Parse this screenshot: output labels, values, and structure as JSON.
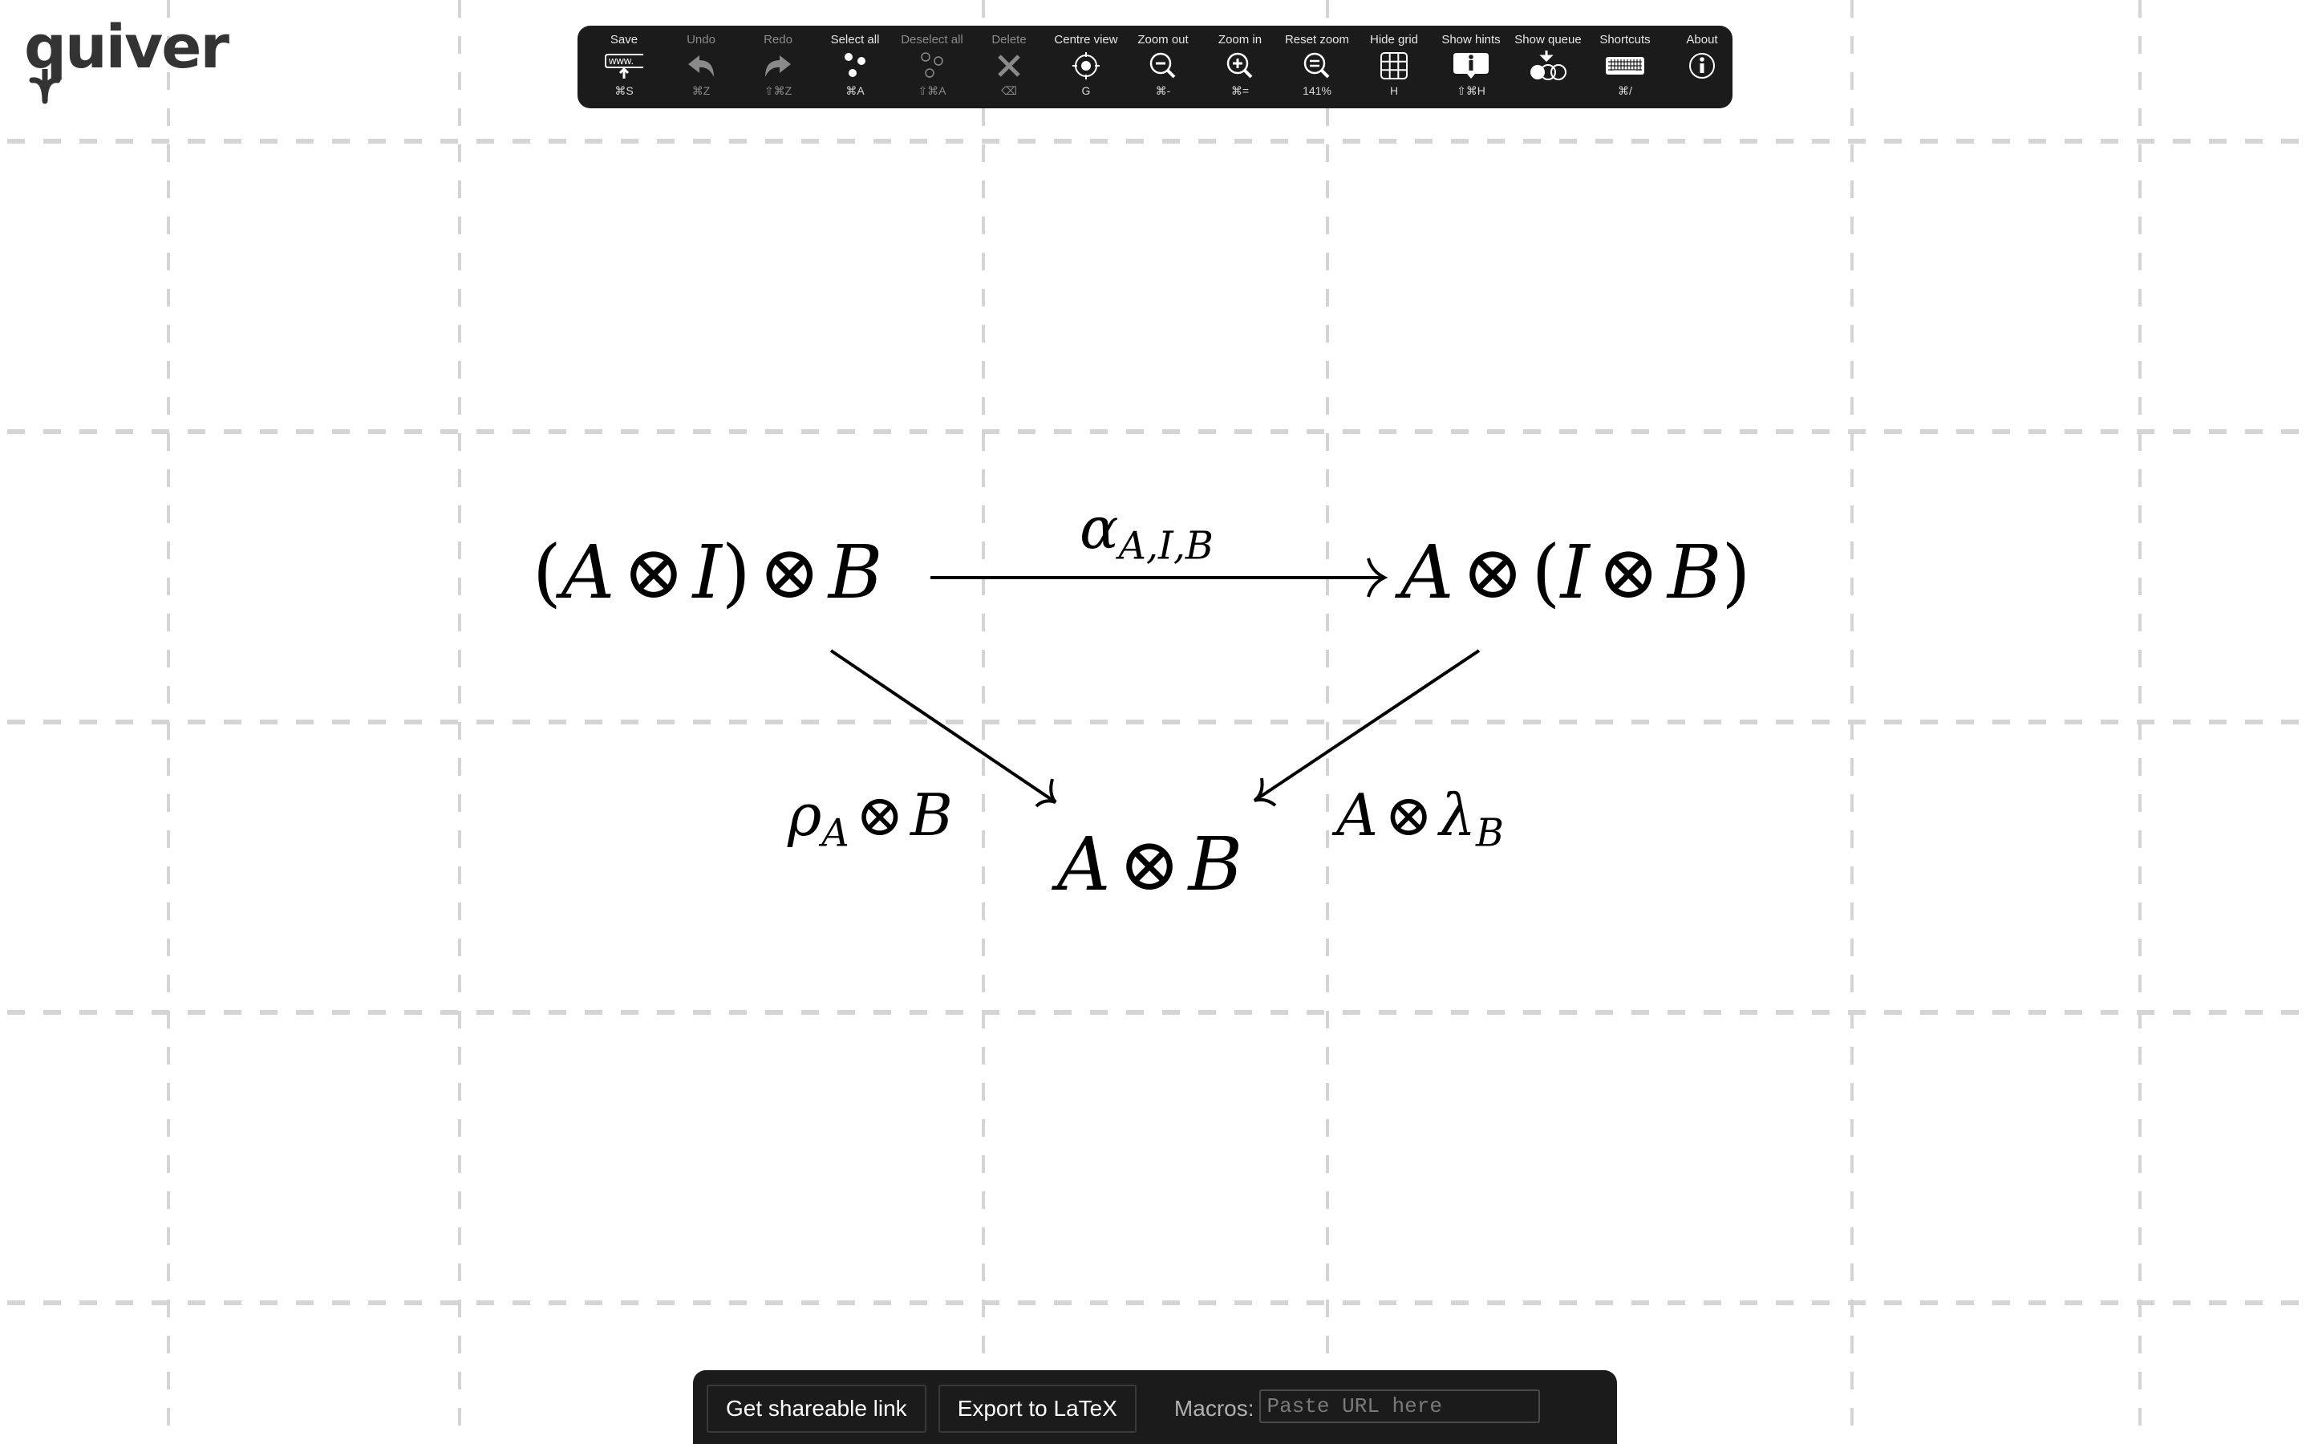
{
  "app": {
    "logo_text": "quiver"
  },
  "toolbar": {
    "items": [
      {
        "id": "save",
        "label": "Save",
        "icon": "save-url-icon",
        "shortcut": "⌘S",
        "enabled": true
      },
      {
        "id": "undo",
        "label": "Undo",
        "icon": "undo-icon",
        "shortcut": "⌘Z",
        "enabled": false
      },
      {
        "id": "redo",
        "label": "Redo",
        "icon": "redo-icon",
        "shortcut": "⇧⌘Z",
        "enabled": false
      },
      {
        "id": "select-all",
        "label": "Select all",
        "icon": "select-all-icon",
        "shortcut": "⌘A",
        "enabled": true
      },
      {
        "id": "deselect-all",
        "label": "Deselect all",
        "icon": "deselect-all-icon",
        "shortcut": "⇧⌘A",
        "enabled": false
      },
      {
        "id": "delete",
        "label": "Delete",
        "icon": "delete-icon",
        "shortcut": "⌫",
        "enabled": false
      },
      {
        "id": "centre-view",
        "label": "Centre view",
        "icon": "centre-view-icon",
        "shortcut": "G",
        "enabled": true
      },
      {
        "id": "zoom-out",
        "label": "Zoom out",
        "icon": "zoom-out-icon",
        "shortcut": "⌘-",
        "enabled": true
      },
      {
        "id": "zoom-in",
        "label": "Zoom in",
        "icon": "zoom-in-icon",
        "shortcut": "⌘=",
        "enabled": true
      },
      {
        "id": "reset-zoom",
        "label": "Reset zoom",
        "icon": "reset-zoom-icon",
        "shortcut": "141%",
        "enabled": true
      },
      {
        "id": "hide-grid",
        "label": "Hide grid",
        "icon": "grid-icon",
        "shortcut": "H",
        "enabled": true
      },
      {
        "id": "show-hints",
        "label": "Show hints",
        "icon": "hints-icon",
        "shortcut": "⇧⌘H",
        "enabled": true
      },
      {
        "id": "show-queue",
        "label": "Show queue",
        "icon": "queue-icon",
        "shortcut": "",
        "enabled": true
      },
      {
        "id": "shortcuts",
        "label": "Shortcuts",
        "icon": "keyboard-icon",
        "shortcut": "⌘/",
        "enabled": true
      },
      {
        "id": "about",
        "label": "About",
        "icon": "info-icon",
        "shortcut": "",
        "enabled": true
      }
    ]
  },
  "diagram": {
    "nodes": [
      {
        "id": "source",
        "tex": "(A \\otimes I) \\otimes B",
        "parts": {
          "open1": "(",
          "a": "A",
          "ot1": "⊗",
          "i": "I",
          "close1": ")",
          "ot2": "⊗",
          "b": "B"
        }
      },
      {
        "id": "target",
        "tex": "A \\otimes (I \\otimes B)",
        "parts": {
          "a": "A",
          "ot1": "⊗",
          "open1": "(",
          "i": "I",
          "ot2": "⊗",
          "b": "B",
          "close1": ")"
        }
      },
      {
        "id": "bottom",
        "tex": "A \\otimes B",
        "parts": {
          "a": "A",
          "ot1": "⊗",
          "b": "B"
        }
      }
    ],
    "edges": [
      {
        "id": "alpha",
        "from": "source",
        "to": "target",
        "tex": "\\alpha_{A,I,B}",
        "parts": {
          "sym": "α",
          "sub": "A,I,B"
        }
      },
      {
        "id": "rho",
        "from": "source",
        "to": "bottom",
        "tex": "\\rho_A \\otimes B",
        "parts": {
          "sym": "ρ",
          "sub": "A",
          "ot": "⊗",
          "rest": "B"
        }
      },
      {
        "id": "lambda",
        "from": "target",
        "to": "bottom",
        "tex": "A \\otimes \\lambda_B",
        "parts": {
          "pre": "A",
          "ot": "⊗",
          "sym": "λ",
          "sub": "B"
        }
      }
    ]
  },
  "bottom_panel": {
    "share_button": "Get shareable link",
    "export_button": "Export to LaTeX",
    "macros_label": "Macros:",
    "macros_placeholder": "Paste URL here",
    "macros_value": ""
  },
  "colors": {
    "toolbar_bg": "#1b1b1b",
    "grid_line": "#d4d4d4",
    "ink": "#000000",
    "logo": "#333333"
  }
}
